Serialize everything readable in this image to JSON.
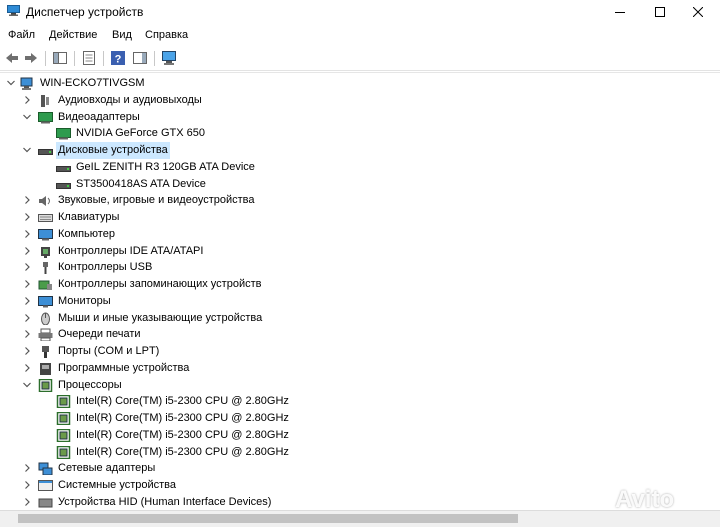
{
  "window": {
    "title": "Диспетчер устройств"
  },
  "menu": [
    "Файл",
    "Действие",
    "Вид",
    "Справка"
  ],
  "tree": {
    "root": "WIN-ECKO7TIVGSM",
    "items": [
      {
        "label": "Аудиовходы и аудиовыходы",
        "icon": "audio-icon",
        "expanded": false,
        "children": []
      },
      {
        "label": "Видеоадаптеры",
        "icon": "display-adapter-icon",
        "expanded": true,
        "children": [
          "NVIDIA GeForce GTX 650"
        ]
      },
      {
        "label": "Дисковые устройства",
        "icon": "disk-icon",
        "expanded": true,
        "selected": true,
        "children": [
          "GeIL    ZENITH R3 120GB ATA Device",
          "ST3500418AS ATA Device"
        ]
      },
      {
        "label": "Звуковые, игровые и видеоустройства",
        "icon": "sound-icon",
        "expanded": false,
        "children": []
      },
      {
        "label": "Клавиатуры",
        "icon": "keyboard-icon",
        "expanded": false,
        "children": []
      },
      {
        "label": "Компьютер",
        "icon": "computer-icon",
        "expanded": false,
        "children": []
      },
      {
        "label": "Контроллеры IDE ATA/ATAPI",
        "icon": "ide-icon",
        "expanded": false,
        "children": []
      },
      {
        "label": "Контроллеры USB",
        "icon": "usb-icon",
        "expanded": false,
        "children": []
      },
      {
        "label": "Контроллеры запоминающих устройств",
        "icon": "storage-controller-icon",
        "expanded": false,
        "children": []
      },
      {
        "label": "Мониторы",
        "icon": "monitor-icon",
        "expanded": false,
        "children": []
      },
      {
        "label": "Мыши и иные указывающие устройства",
        "icon": "mouse-icon",
        "expanded": false,
        "children": []
      },
      {
        "label": "Очереди печати",
        "icon": "printer-icon",
        "expanded": false,
        "children": []
      },
      {
        "label": "Порты (COM и LPT)",
        "icon": "port-icon",
        "expanded": false,
        "children": []
      },
      {
        "label": "Программные устройства",
        "icon": "software-device-icon",
        "expanded": false,
        "children": []
      },
      {
        "label": "Процессоры",
        "icon": "cpu-icon",
        "expanded": true,
        "children": [
          "Intel(R) Core(TM) i5-2300 CPU @ 2.80GHz",
          "Intel(R) Core(TM) i5-2300 CPU @ 2.80GHz",
          "Intel(R) Core(TM) i5-2300 CPU @ 2.80GHz",
          "Intel(R) Core(TM) i5-2300 CPU @ 2.80GHz"
        ]
      },
      {
        "label": "Сетевые адаптеры",
        "icon": "network-icon",
        "expanded": false,
        "children": []
      },
      {
        "label": "Системные устройства",
        "icon": "system-icon",
        "expanded": false,
        "children": []
      },
      {
        "label": "Устройства HID (Human Interface Devices)",
        "icon": "hid-icon",
        "expanded": false,
        "children": []
      }
    ]
  },
  "watermark": "Avito",
  "colors": {
    "selection": "#cce8ff",
    "accent": "#1e74c8"
  }
}
